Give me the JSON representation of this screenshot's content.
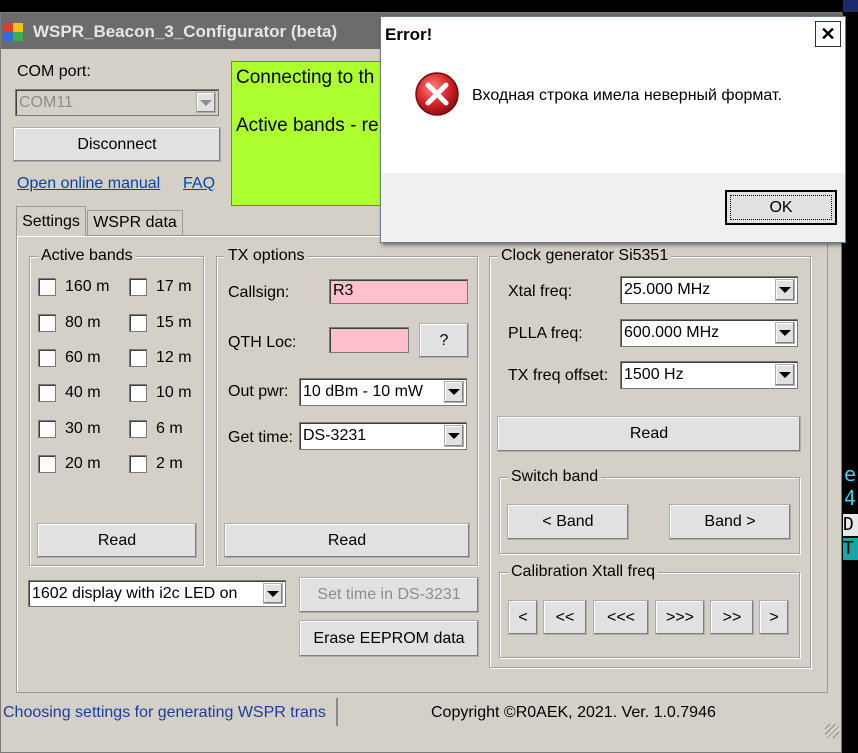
{
  "window": {
    "title": "WSPR_Beacon_3_Configurator (beta)"
  },
  "com": {
    "label": "COM port:",
    "value": "COM11"
  },
  "buttons": {
    "disconnect": "Disconnect"
  },
  "links": {
    "manual": "Open online manual",
    "faq": "FAQ"
  },
  "console": {
    "lines": [
      "Connecting to th",
      "",
      "Active bands - re"
    ]
  },
  "tabs": [
    {
      "label": "Settings"
    },
    {
      "label": "WSPR data"
    }
  ],
  "active_bands": {
    "title": "Active bands",
    "col1": [
      "160 m",
      "80 m",
      "60 m",
      "40 m",
      "30 m",
      "20 m"
    ],
    "col2": [
      "17 m",
      "15 m",
      "12 m",
      "10 m",
      "6 m",
      "2 m"
    ],
    "read": "Read"
  },
  "tx": {
    "title": "TX options",
    "callsign_label": "Callsign:",
    "callsign_value": "R3",
    "qth_label": "QTH Loc:",
    "qth_value": "",
    "qth_help": "?",
    "outpwr_label": "Out pwr:",
    "outpwr_value": "10 dBm - 10 mW",
    "gettime_label": "Get time:",
    "gettime_value": "DS-3231",
    "read": "Read"
  },
  "clock": {
    "title": "Clock generator Si5351",
    "xtal_label": "Xtal freq:",
    "xtal_value": "25.000 MHz",
    "plla_label": "PLLA freq:",
    "plla_value": "600.000 MHz",
    "offset_label": "TX freq offset:",
    "offset_value": "1500 Hz",
    "read": "Read"
  },
  "switch_band": {
    "title": "Switch band",
    "prev": "< Band",
    "next": "Band >"
  },
  "calibration": {
    "title": "Calibration Xtall freq",
    "buttons": [
      "<",
      "<<",
      "<<<",
      ">>>",
      ">>",
      ">"
    ]
  },
  "display": {
    "value": "1602 display with i2c LED on"
  },
  "set_time": "Set time in DS-3231",
  "erase": "Erase EEPROM data",
  "status": {
    "left": "Choosing settings for generating WSPR trans",
    "right": "Copyright ©R0AEK, 2021. Ver. 1.0.7946"
  },
  "dialog": {
    "title": "Error!",
    "message": "Входная строка имела неверный формат.",
    "ok": "OK"
  },
  "background": {
    "chars": [
      "e",
      "4",
      "D",
      "T"
    ]
  },
  "colors": {
    "console_bg": "#adff2f",
    "input_pink": "#ffc0cb",
    "link": "#0645ad",
    "status_text": "#1a3e9c"
  }
}
